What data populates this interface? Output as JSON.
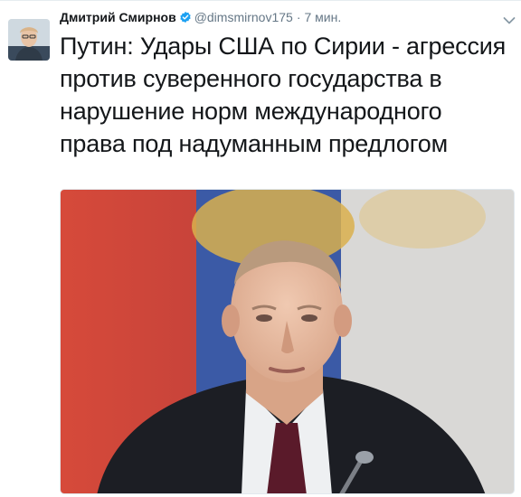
{
  "tweet": {
    "author_name": "Дмитрий Смирнов",
    "username": "@dimsmirnov175",
    "separator": "·",
    "time": "7 мин.",
    "text": "Путин: Удары США по Сирии - агрессия против суверенного государства в нарушение норм международного права под надуманным предлогом"
  },
  "icons": {
    "verified": "verified-badge-icon",
    "caret": "chevron-down-icon"
  },
  "colors": {
    "text": "#14171a",
    "secondary": "#657786",
    "verified": "#1da1f2"
  }
}
